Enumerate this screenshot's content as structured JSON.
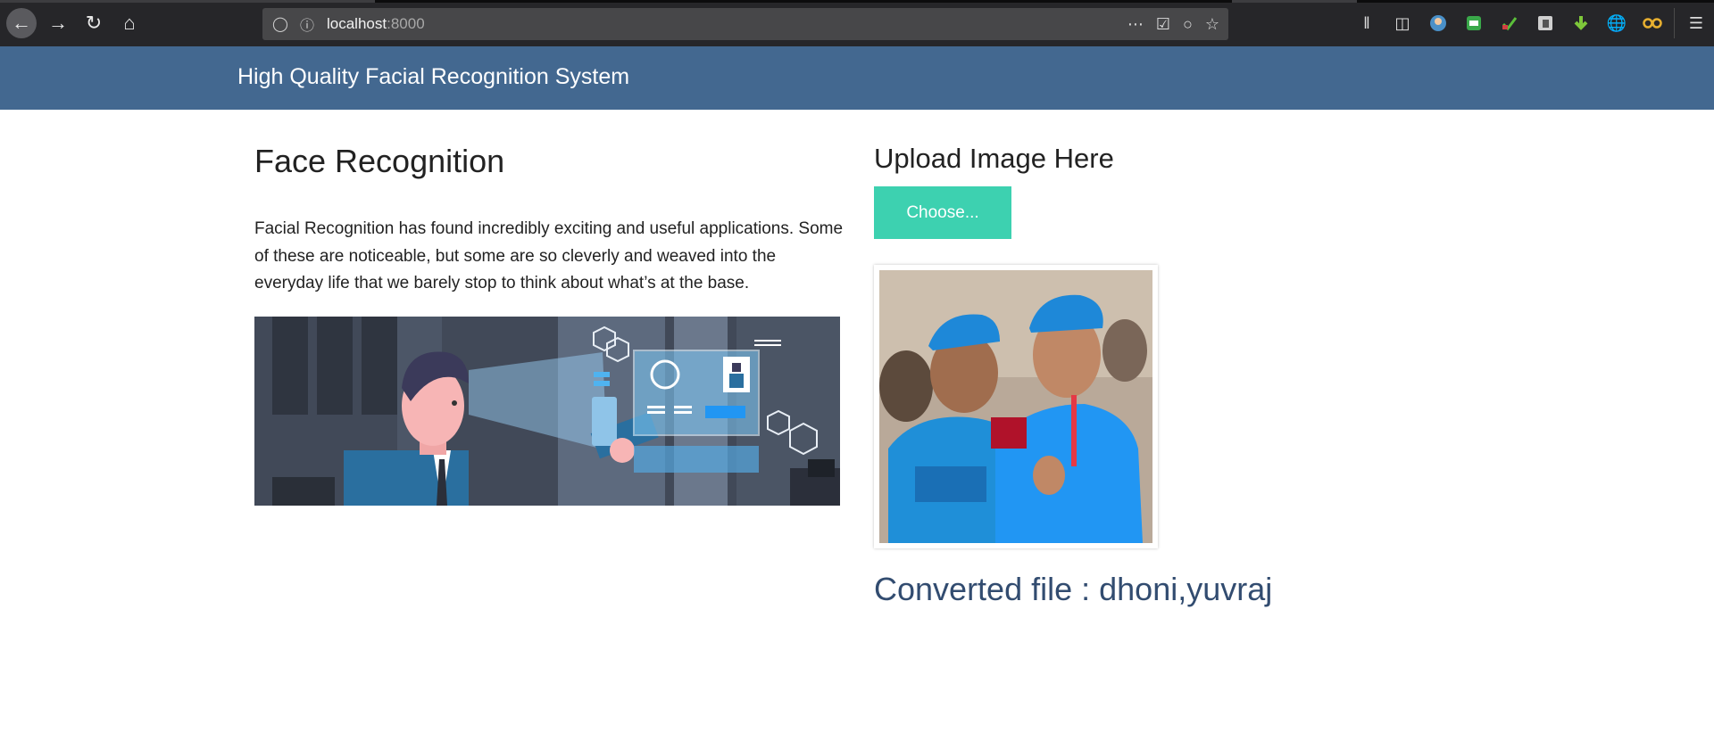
{
  "browser": {
    "url_host": "localhost",
    "url_port": ":8000"
  },
  "app": {
    "brand": "High Quality Facial Recognition System"
  },
  "left": {
    "title": "Face Recognition",
    "paragraph": "Facial Recognition has found incredibly exciting and useful applications. Some of these are noticeable, but some are so cleverly and weaved into the everyday life that we barely stop to think about what’s at the base.",
    "illustration_icon": "face-scan-illustration"
  },
  "right": {
    "upload_title": "Upload Image Here",
    "choose_label": "Choose...",
    "result_label": "Converted file : dhoni,yuvraj"
  },
  "colors": {
    "header": "#436890",
    "button": "#3dd1b0",
    "result_text": "#324c70"
  }
}
